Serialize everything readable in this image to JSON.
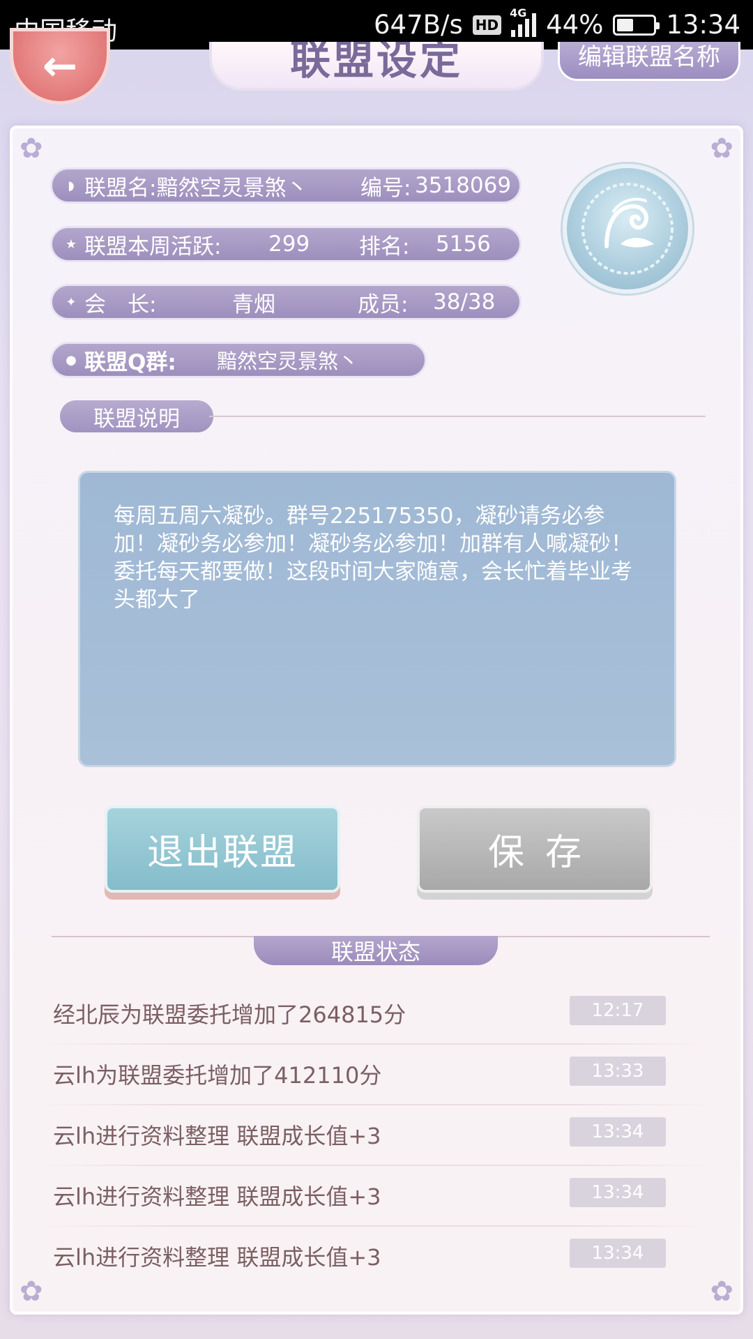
{
  "status_bar": {
    "carrier": "中国移动",
    "net_speed": "647B/s",
    "hd": "HD",
    "network": "4G",
    "battery": "44%",
    "battery_level": 0.44,
    "time": "13:34"
  },
  "header": {
    "title": "联盟设定",
    "rename_label": "编辑联盟名称"
  },
  "alliance": {
    "name_label": "联盟名:",
    "name": "黯然空灵景煞丶",
    "id_label": "编号:",
    "id": "3518069",
    "activity_label": "联盟本周活跃:",
    "activity": "299",
    "rank_label": "排名:",
    "rank": "5156",
    "leader_label": "会　长:",
    "leader": "青烟",
    "members_label": "成员:",
    "members": "38/38",
    "qgroup_label": "联盟Q群:",
    "qgroup": "黯然空灵景煞丶"
  },
  "description": {
    "section_label": "联盟说明",
    "text": "每周五周六凝砂。群号225175350，凝砂请务必参加！凝砂务必参加！凝砂务必参加！加群有人喊凝砂！委托每天都要做！这段时间大家随意，会长忙着毕业考头都大了"
  },
  "buttons": {
    "exit": "退出联盟",
    "save": "保存"
  },
  "status": {
    "section_label": "联盟状态",
    "logs": [
      {
        "message": "经北辰为联盟委托增加了264815分",
        "time": "12:17"
      },
      {
        "message": "云lh为联盟委托增加了412110分",
        "time": "13:33"
      },
      {
        "message": "云lh进行资料整理 联盟成长值+3",
        "time": "13:34"
      },
      {
        "message": "云lh进行资料整理 联盟成长值+3",
        "time": "13:34"
      },
      {
        "message": "云lh进行资料整理 联盟成长值+3",
        "time": "13:34"
      }
    ]
  },
  "colors": {
    "pill": "#a597c4",
    "desc_box": "#a5bcd6",
    "exit_button": "#93c5d2",
    "save_button": "#b5b5b5",
    "log_text": "#7b5f63"
  }
}
